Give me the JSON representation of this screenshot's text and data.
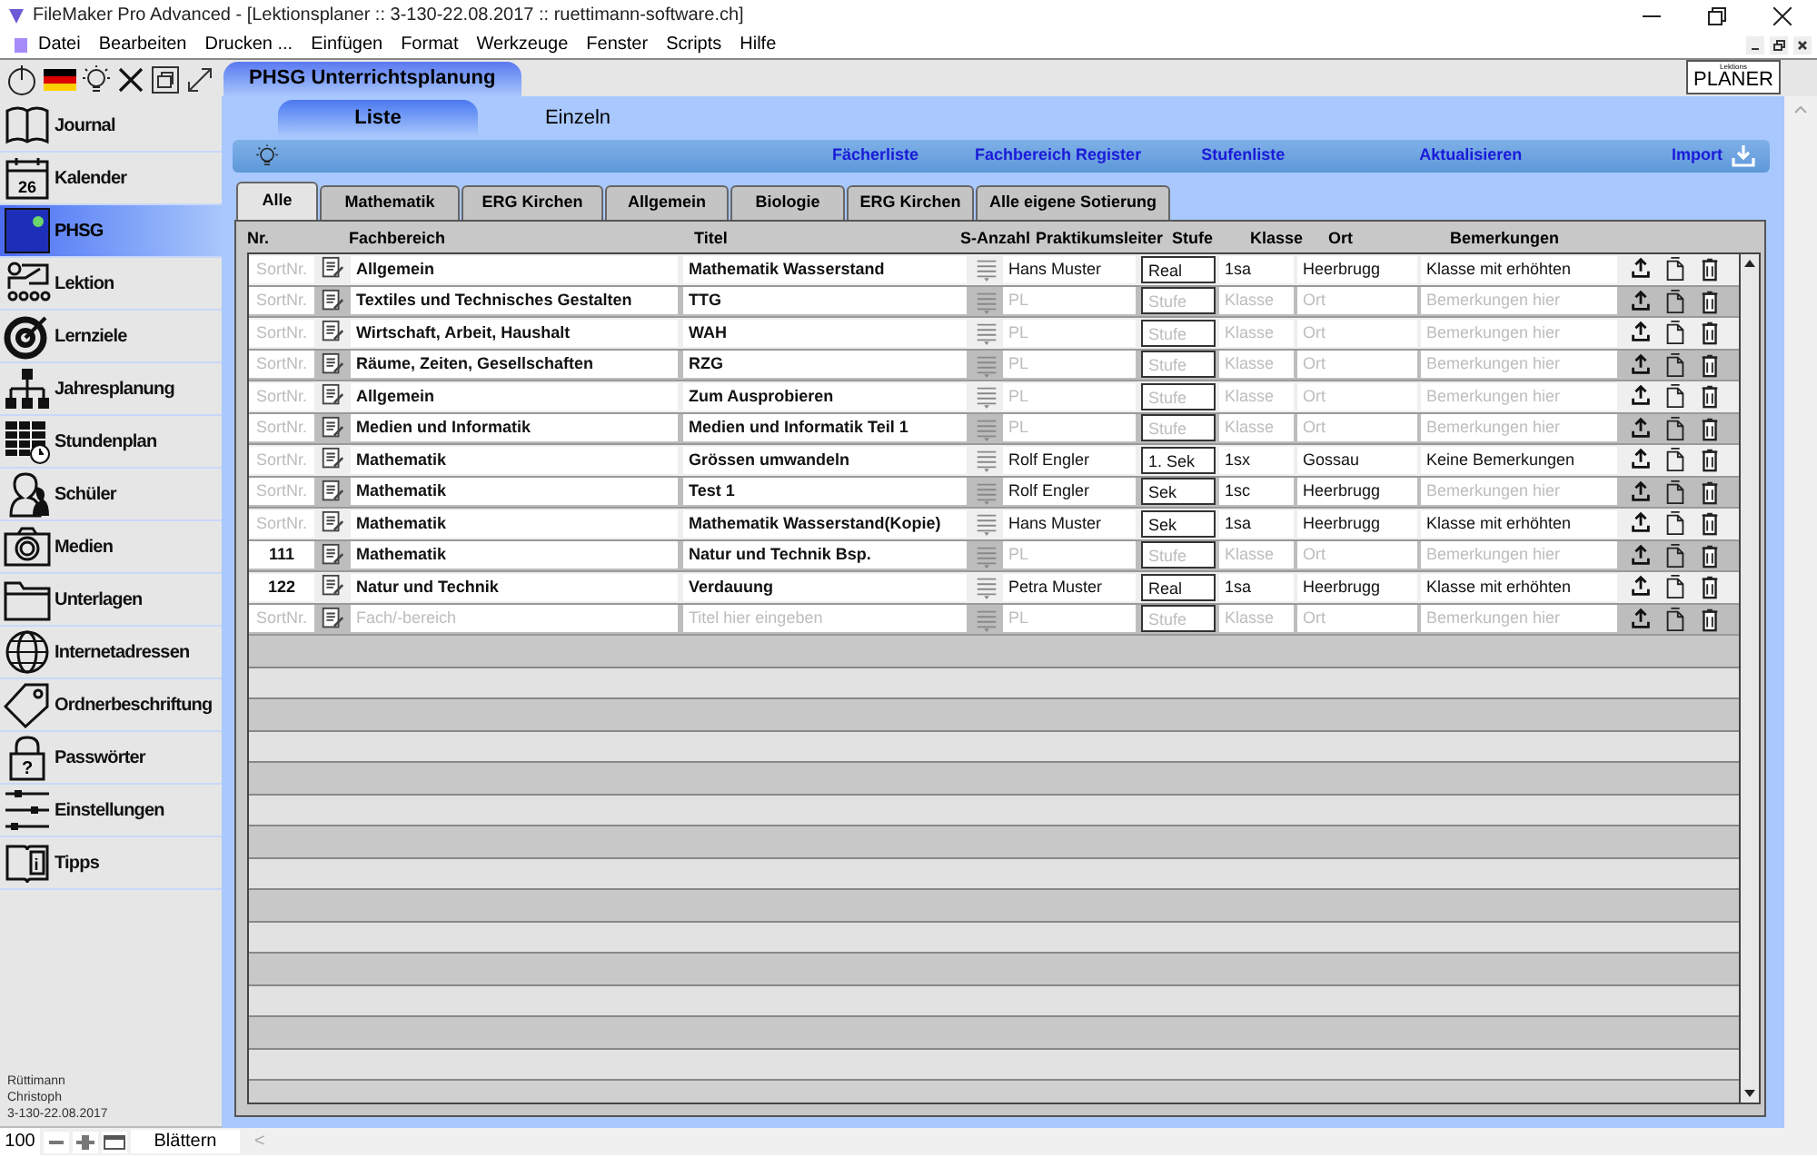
{
  "window": {
    "title": "FileMaker Pro Advanced - [Lektionsplaner :: 3-130-22.08.2017 :: ruettimann-software.ch]"
  },
  "menu": [
    "Datei",
    "Bearbeiten",
    "Drucken ...",
    "Einfügen",
    "Format",
    "Werkzeuge",
    "Fenster",
    "Scripts",
    "Hilfe"
  ],
  "sidebar": {
    "items": [
      {
        "label": "Journal",
        "selected": false
      },
      {
        "label": "Kalender",
        "selected": false,
        "icon_text": "26"
      },
      {
        "label": "PHSG",
        "selected": true
      },
      {
        "label": "Lektion",
        "selected": false
      },
      {
        "label": "Lernziele",
        "selected": false
      },
      {
        "label": "Jahresplanung",
        "selected": false
      },
      {
        "label": "Stundenplan",
        "selected": false
      },
      {
        "label": "Schüler",
        "selected": false
      },
      {
        "label": "Medien",
        "selected": false
      },
      {
        "label": "Unterlagen",
        "selected": false
      },
      {
        "label": "Internetadressen",
        "selected": false
      },
      {
        "label": "Ordnerbeschriftung",
        "selected": false
      },
      {
        "label": "Passwörter",
        "selected": false,
        "icon_text": "?"
      },
      {
        "label": "Einstellungen",
        "selected": false
      },
      {
        "label": "Tipps",
        "selected": false,
        "icon_text": "i"
      }
    ],
    "footer": [
      "Rüttimann",
      "Christoph",
      "3-130-22.08.2017"
    ]
  },
  "layout_tab": "PHSG Unterrichtsplanung",
  "logo": {
    "small": "Lektions",
    "text": "PLANER"
  },
  "view_tabs": [
    {
      "label": "Liste",
      "selected": true
    },
    {
      "label": "Einzeln",
      "selected": false
    }
  ],
  "toolbar": {
    "links": [
      "Fächerliste",
      "Fachbereich Register",
      "Stufenliste",
      "Aktualisieren"
    ],
    "import": "Import"
  },
  "tabs": [
    {
      "label": "Alle",
      "selected": true
    },
    {
      "label": "Mathematik",
      "selected": false
    },
    {
      "label": "ERG Kirchen",
      "selected": false
    },
    {
      "label": "Allgemein",
      "selected": false
    },
    {
      "label": "Biologie",
      "selected": false
    },
    {
      "label": "ERG Kirchen",
      "selected": false
    },
    {
      "label": "Alle eigene Sotierung",
      "selected": false
    }
  ],
  "table": {
    "columns": [
      "Nr.",
      "Fachbereich",
      "Titel",
      "S-Anzahl",
      "Praktikumsleiter",
      "Stufe",
      "Klasse",
      "Ort",
      "Bemerkungen"
    ],
    "rows": [
      {
        "nr": {
          "placeholder": "SortNr."
        },
        "fachbereich": {
          "value": "Allgemein"
        },
        "titel": {
          "value": "Mathematik Wasserstand"
        },
        "leiter": {
          "value": "Hans Muster"
        },
        "stufe": {
          "value": "Real"
        },
        "klasse": {
          "value": "1sa"
        },
        "ort": {
          "value": "Heerbrugg"
        },
        "bemerkungen": {
          "value": "Klasse mit erhöhten"
        }
      },
      {
        "nr": {
          "placeholder": "SortNr."
        },
        "fachbereich": {
          "value": "Textiles und Technisches Gestalten"
        },
        "titel": {
          "value": "TTG"
        },
        "leiter": {
          "placeholder": "PL"
        },
        "stufe": {
          "placeholder": "Stufe"
        },
        "klasse": {
          "placeholder": "Klasse"
        },
        "ort": {
          "placeholder": "Ort"
        },
        "bemerkungen": {
          "placeholder": "Bemerkungen hier"
        }
      },
      {
        "nr": {
          "placeholder": "SortNr."
        },
        "fachbereich": {
          "value": "Wirtschaft, Arbeit, Haushalt"
        },
        "titel": {
          "value": "WAH"
        },
        "leiter": {
          "placeholder": "PL"
        },
        "stufe": {
          "placeholder": "Stufe"
        },
        "klasse": {
          "placeholder": "Klasse"
        },
        "ort": {
          "placeholder": "Ort"
        },
        "bemerkungen": {
          "placeholder": "Bemerkungen hier"
        }
      },
      {
        "nr": {
          "placeholder": "SortNr."
        },
        "fachbereich": {
          "value": "Räume, Zeiten, Gesellschaften"
        },
        "titel": {
          "value": "RZG"
        },
        "leiter": {
          "placeholder": "PL"
        },
        "stufe": {
          "placeholder": "Stufe"
        },
        "klasse": {
          "placeholder": "Klasse"
        },
        "ort": {
          "placeholder": "Ort"
        },
        "bemerkungen": {
          "placeholder": "Bemerkungen hier"
        }
      },
      {
        "nr": {
          "placeholder": "SortNr."
        },
        "fachbereich": {
          "value": "Allgemein"
        },
        "titel": {
          "value": "Zum Ausprobieren"
        },
        "leiter": {
          "placeholder": "PL"
        },
        "stufe": {
          "placeholder": "Stufe"
        },
        "klasse": {
          "placeholder": "Klasse"
        },
        "ort": {
          "placeholder": "Ort"
        },
        "bemerkungen": {
          "placeholder": "Bemerkungen hier"
        }
      },
      {
        "nr": {
          "placeholder": "SortNr."
        },
        "fachbereich": {
          "value": "Medien und Informatik"
        },
        "titel": {
          "value": "Medien und Informatik Teil 1"
        },
        "leiter": {
          "placeholder": "PL"
        },
        "stufe": {
          "placeholder": "Stufe"
        },
        "klasse": {
          "placeholder": "Klasse"
        },
        "ort": {
          "placeholder": "Ort"
        },
        "bemerkungen": {
          "placeholder": "Bemerkungen hier"
        }
      },
      {
        "nr": {
          "placeholder": "SortNr."
        },
        "fachbereich": {
          "value": "Mathematik"
        },
        "titel": {
          "value": "Grössen umwandeln"
        },
        "leiter": {
          "value": "Rolf Engler"
        },
        "stufe": {
          "value": "1. Sek"
        },
        "klasse": {
          "value": "1sx"
        },
        "ort": {
          "value": "Gossau"
        },
        "bemerkungen": {
          "value": "Keine Bemerkungen"
        }
      },
      {
        "nr": {
          "placeholder": "SortNr."
        },
        "fachbereich": {
          "value": "Mathematik"
        },
        "titel": {
          "value": "Test 1"
        },
        "leiter": {
          "value": "Rolf Engler"
        },
        "stufe": {
          "value": "Sek"
        },
        "klasse": {
          "value": "1sc"
        },
        "ort": {
          "value": "Heerbrugg"
        },
        "bemerkungen": {
          "placeholder": "Bemerkungen hier"
        }
      },
      {
        "nr": {
          "placeholder": "SortNr."
        },
        "fachbereich": {
          "value": "Mathematik"
        },
        "titel": {
          "value": "Mathematik Wasserstand(Kopie)"
        },
        "leiter": {
          "value": "Hans Muster"
        },
        "stufe": {
          "value": "Sek"
        },
        "klasse": {
          "value": "1sa"
        },
        "ort": {
          "value": "Heerbrugg"
        },
        "bemerkungen": {
          "value": "Klasse mit erhöhten"
        }
      },
      {
        "nr": {
          "value": "111"
        },
        "fachbereich": {
          "value": "Mathematik"
        },
        "titel": {
          "value": "Natur und Technik Bsp."
        },
        "leiter": {
          "placeholder": "PL"
        },
        "stufe": {
          "placeholder": "Stufe"
        },
        "klasse": {
          "placeholder": "Klasse"
        },
        "ort": {
          "placeholder": "Ort"
        },
        "bemerkungen": {
          "placeholder": "Bemerkungen hier"
        }
      },
      {
        "nr": {
          "value": "122"
        },
        "fachbereich": {
          "value": "Natur und Technik"
        },
        "titel": {
          "value": "Verdauung"
        },
        "leiter": {
          "value": "Petra Muster"
        },
        "stufe": {
          "value": "Real"
        },
        "klasse": {
          "value": "1sa"
        },
        "ort": {
          "value": "Heerbrugg"
        },
        "bemerkungen": {
          "value": "Klasse mit erhöhten"
        }
      },
      {
        "nr": {
          "placeholder": "SortNr."
        },
        "fachbereich": {
          "placeholder": "Fach/-bereich"
        },
        "titel": {
          "placeholder": "Titel hier eingeben"
        },
        "leiter": {
          "placeholder": "PL"
        },
        "stufe": {
          "placeholder": "Stufe"
        },
        "klasse": {
          "placeholder": "Klasse"
        },
        "ort": {
          "placeholder": "Ort"
        },
        "bemerkungen": {
          "placeholder": "Bemerkungen hier"
        }
      }
    ]
  },
  "status_bar": {
    "zoom": "100",
    "mode": "Blättern",
    "scroll_left": "<"
  }
}
